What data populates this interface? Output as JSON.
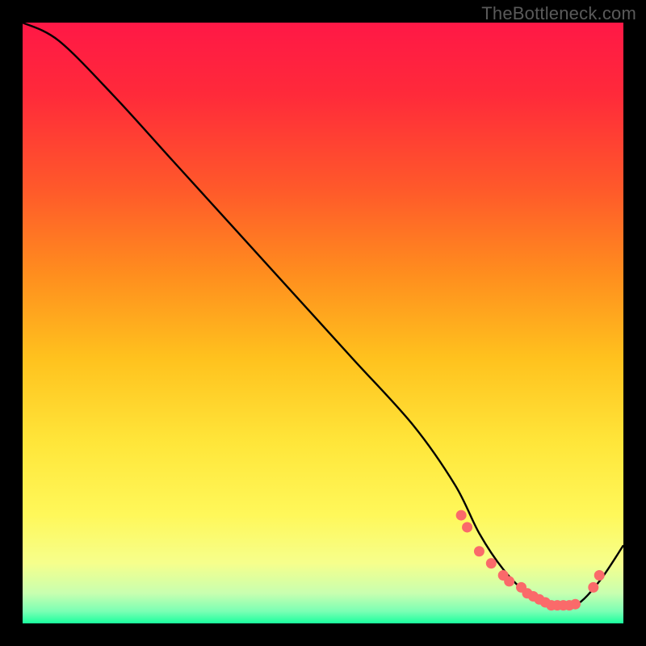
{
  "watermark": "TheBottleneck.com",
  "chart_data": {
    "type": "line",
    "title": "",
    "xlabel": "",
    "ylabel": "",
    "xlim": [
      0,
      100
    ],
    "ylim": [
      0,
      100
    ],
    "grid": false,
    "curve": {
      "x": [
        0,
        6,
        15,
        25,
        35,
        45,
        55,
        65,
        72,
        76,
        80,
        84,
        88,
        92,
        96,
        100
      ],
      "y": [
        100,
        97,
        88,
        77,
        66,
        55,
        44,
        33,
        23,
        15,
        9,
        5,
        3,
        3,
        7,
        13
      ]
    },
    "valley_points": {
      "x": [
        73,
        74,
        76,
        78,
        80,
        81,
        83,
        84,
        85,
        86,
        87,
        88,
        89,
        90,
        91,
        92,
        95,
        96
      ],
      "y": [
        18,
        16,
        12,
        10,
        8,
        7,
        6,
        5,
        4.5,
        4,
        3.5,
        3,
        3,
        3,
        3,
        3.2,
        6,
        8
      ]
    },
    "gradient_stops": [
      {
        "offset": 0.0,
        "color": "#ff1846"
      },
      {
        "offset": 0.12,
        "color": "#ff2a3a"
      },
      {
        "offset": 0.28,
        "color": "#ff5a2a"
      },
      {
        "offset": 0.42,
        "color": "#ff8e1e"
      },
      {
        "offset": 0.56,
        "color": "#ffc21e"
      },
      {
        "offset": 0.7,
        "color": "#ffe63a"
      },
      {
        "offset": 0.82,
        "color": "#fff85a"
      },
      {
        "offset": 0.9,
        "color": "#f6ff8c"
      },
      {
        "offset": 0.95,
        "color": "#c8ffb0"
      },
      {
        "offset": 0.98,
        "color": "#7affb4"
      },
      {
        "offset": 1.0,
        "color": "#1aff9e"
      }
    ],
    "dot_color": "#fa6a6a",
    "curve_color": "#000000"
  }
}
